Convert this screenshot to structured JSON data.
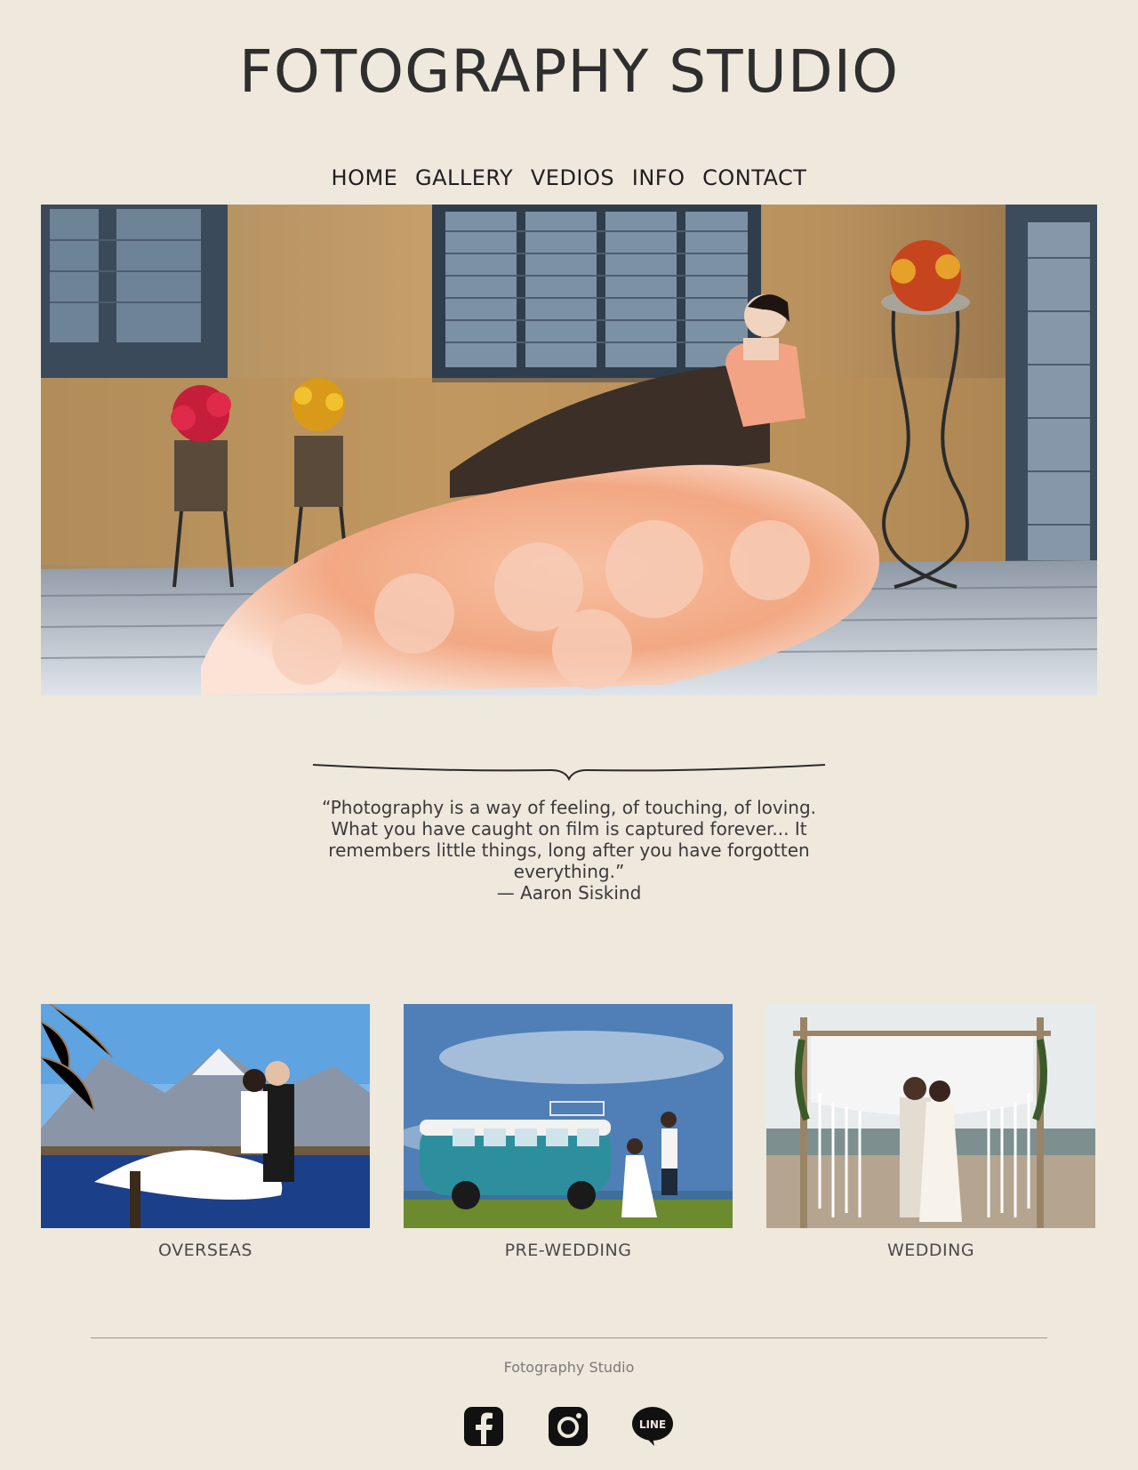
{
  "site": {
    "title": "FOTOGRAPHY STUDIO"
  },
  "nav": {
    "items": [
      {
        "label": "HOME"
      },
      {
        "label": "GALLERY"
      },
      {
        "label": "VEDIOS"
      },
      {
        "label": "INFO"
      },
      {
        "label": "CONTACT"
      }
    ]
  },
  "hero": {
    "image_subject": "bride in peach ruffled gown seated on bench"
  },
  "quote": {
    "text": "“Photography is a way of feeling, of touching, of loving. What you have caught on film is captured forever... It remembers little things, long after you have forgotten everything.”",
    "author": "— Aaron Siskind"
  },
  "categories": [
    {
      "label": "OVERSEAS"
    },
    {
      "label": "PRE-WEDDING"
    },
    {
      "label": "WEDDING"
    }
  ],
  "footer": {
    "name": "Fotography Studio",
    "social": [
      {
        "icon": "facebook-icon"
      },
      {
        "icon": "instagram-icon"
      },
      {
        "icon": "line-icon",
        "text": "LINE"
      }
    ]
  },
  "colors": {
    "background": "#efe8dc",
    "text": "#2b2b2b"
  }
}
